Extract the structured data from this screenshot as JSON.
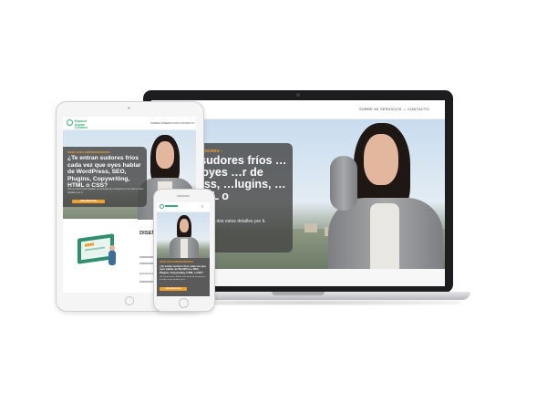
{
  "laptop": {
    "nav": [
      "SOBRE MÍ",
      "SERVICIOS ⌄",
      "CONTACTO"
    ],
    "tag": "… PARA EMPRENDEDORES ~",
    "headline": "…ntran sudores fríos …vez que oyes …r de WordPress, …lugins, …iting, HTML o",
    "body": "…Estaré encantada de …dos estos detalles por ti.",
    "cta": "…SERVICIOS"
  },
  "tablet": {
    "logo": "Espacio Digital Creativo",
    "nav": [
      "SOBRE MÍ",
      "SERVICIOS",
      "CONTACTO"
    ],
    "tag": "WEBS PARA EMPRENDEDORES",
    "headline": "¿Te entran sudores fríos cada vez que oyes hablar de WordPress, SEO, Plugins, Copywriting, HTML o CSS?",
    "body": "¡No te preocupes! Estaré encantada de encargarme de todos estos detalles por ti.",
    "cta": "VER SERVICIOS",
    "section_title": "DISEÑ… ME… W…",
    "section_body": "profesiones liberales…"
  },
  "phone": {
    "tag": "WEBS PARA EMPRENDEDORES",
    "headline": "¿Te entran sudores fríos cada vez que oyes hablar de WordPress, SEO, Plugins, Copywriting, HTML o CSS?",
    "body": "¡No te preocupes! Estaré encantada de encargarme de todos estos detalles por ti.",
    "cta": "VER SERVICIOS"
  },
  "colors": {
    "accent": "#f0a02a",
    "brand": "#3aaa7c",
    "overlay": "#464646"
  }
}
